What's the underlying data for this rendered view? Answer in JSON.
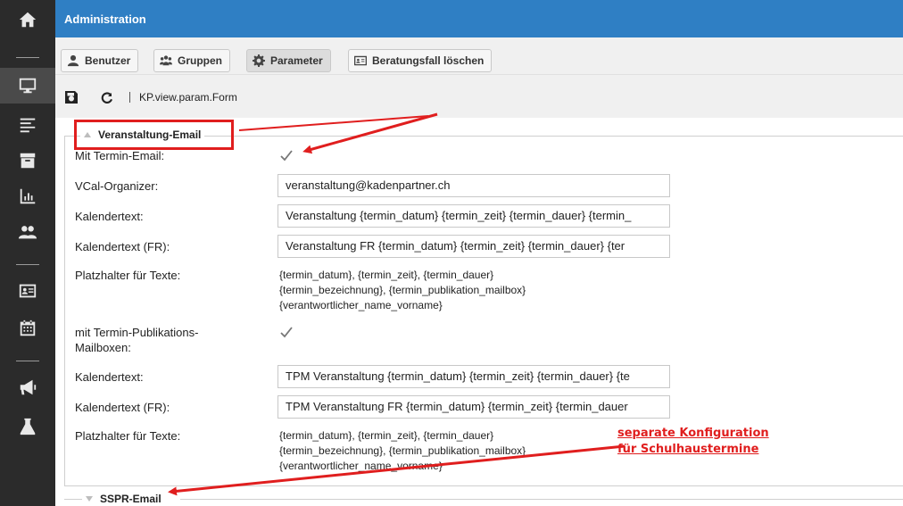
{
  "app": {
    "title": "Administration"
  },
  "sidebar": {
    "items": [
      {
        "icon": "home-icon"
      },
      {
        "icon": "monitor-icon"
      },
      {
        "icon": "list-icon"
      },
      {
        "icon": "archive-icon"
      },
      {
        "icon": "bar-chart-icon"
      },
      {
        "icon": "users-icon"
      },
      {
        "icon": "id-card-icon"
      },
      {
        "icon": "calendar-icon"
      },
      {
        "icon": "megaphone-icon"
      },
      {
        "icon": "flask-icon"
      }
    ]
  },
  "toolbar": {
    "buttons": [
      {
        "label": "Benutzer",
        "icon": "user-icon"
      },
      {
        "label": "Gruppen",
        "icon": "group-icon"
      },
      {
        "label": "Parameter",
        "icon": "gear-icon",
        "active": true
      },
      {
        "label": "Beratungsfall löschen",
        "icon": "id-card-icon"
      }
    ]
  },
  "toolbar2": {
    "save_icon": "save-icon",
    "refresh_icon": "refresh-icon",
    "path": "KP.view.param.Form"
  },
  "section1": {
    "legend": "Veranstaltung-Email",
    "fields": {
      "mit_termin_email": {
        "label": "Mit Termin-Email:",
        "checked": true
      },
      "vcal_organizer": {
        "label": "VCal-Organizer:",
        "value": "veranstaltung@kadenpartner.ch"
      },
      "kalendertext": {
        "label": "Kalendertext:",
        "value": "Veranstaltung {termin_datum} {termin_zeit} {termin_dauer} {termin_"
      },
      "kalendertext_fr": {
        "label": "Kalendertext (FR):",
        "value": "Veranstaltung FR {termin_datum} {termin_zeit} {termin_dauer} {ter"
      },
      "platzhalter": {
        "label": "Platzhalter für Texte:",
        "lines": [
          "{termin_datum}, {termin_zeit}, {termin_dauer}",
          "{termin_bezeichnung}, {termin_publikation_mailbox}",
          "{verantwortlicher_name_vorname}"
        ]
      },
      "mit_publikations": {
        "label_line1": "mit Termin-Publikations-",
        "label_line2": "Mailboxen:",
        "checked": true
      },
      "tpm_kalendertext": {
        "label": "Kalendertext:",
        "value": "TPM Veranstaltung {termin_datum} {termin_zeit} {termin_dauer} {te"
      },
      "tpm_kalendertext_fr": {
        "label": "Kalendertext (FR):",
        "value": "TPM Veranstaltung FR {termin_datum} {termin_zeit} {termin_dauer"
      },
      "platzhalter2": {
        "label": "Platzhalter für Texte:",
        "lines": [
          "{termin_datum}, {termin_zeit}, {termin_dauer}",
          "{termin_bezeichnung}, {termin_publikation_mailbox}",
          "{verantwortlicher_name_vorname}"
        ]
      }
    }
  },
  "section2": {
    "legend": "SSPR-Email"
  },
  "annotation": {
    "line1": "separate Konfiguration",
    "line2": "für Schulhaustermine",
    "color": "#e01e1e"
  },
  "colors": {
    "titlebar": "#2f7fc4",
    "sidebar": "#2b2b2b"
  }
}
